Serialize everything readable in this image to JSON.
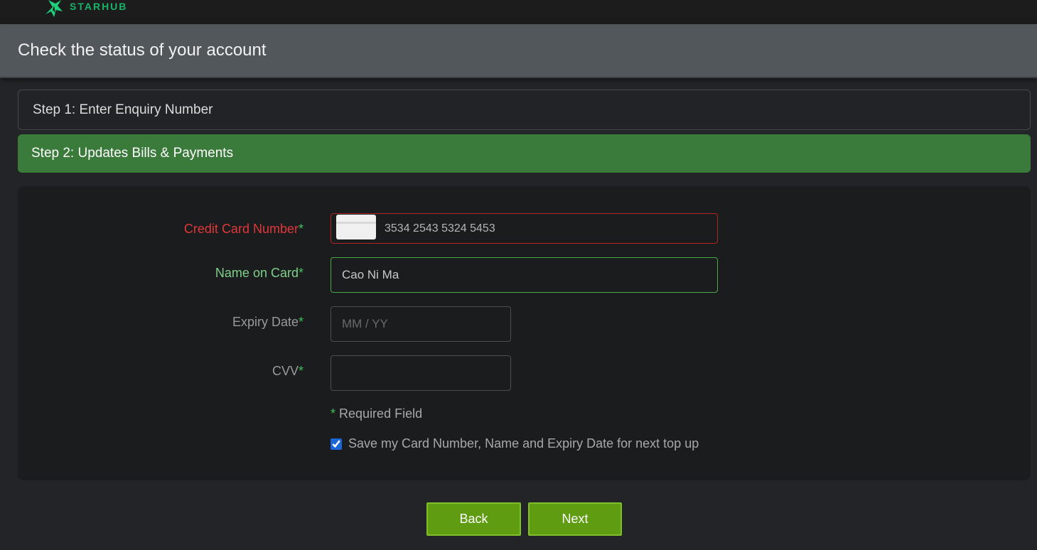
{
  "brand": {
    "name": "STARHUB",
    "color": "#18b368"
  },
  "page": {
    "title": "Check the status of your account"
  },
  "steps": [
    {
      "label": "Step 1: Enter Enquiry Number",
      "active": false
    },
    {
      "label": "Step 2: Updates Bills & Payments",
      "active": true
    }
  ],
  "form": {
    "card_number": {
      "label": "Credit Card Number",
      "value": "3534 2543 5324 5453",
      "state": "error"
    },
    "name_on_card": {
      "label": "Name on Card",
      "value": "Cao Ni Ma",
      "state": "valid"
    },
    "expiry": {
      "label": "Expiry Date",
      "value": "",
      "placeholder": "MM / YY"
    },
    "cvv": {
      "label": "CVV",
      "value": ""
    },
    "required_star": "*",
    "required_note": "Required Field",
    "save_checkbox": {
      "label": "Save my Card Number, Name and Expiry Date for next top up",
      "checked": true
    }
  },
  "buttons": {
    "back": "Back",
    "next": "Next"
  },
  "colors": {
    "accent_green": "#3a7a3b",
    "button_green": "#5f9c12",
    "error_red": "#e0383a",
    "valid_green": "#7fd08a"
  },
  "icons": {
    "logo": "starhub-logo-icon",
    "card": "credit-card-icon",
    "check": "checkbox-checked-icon"
  }
}
